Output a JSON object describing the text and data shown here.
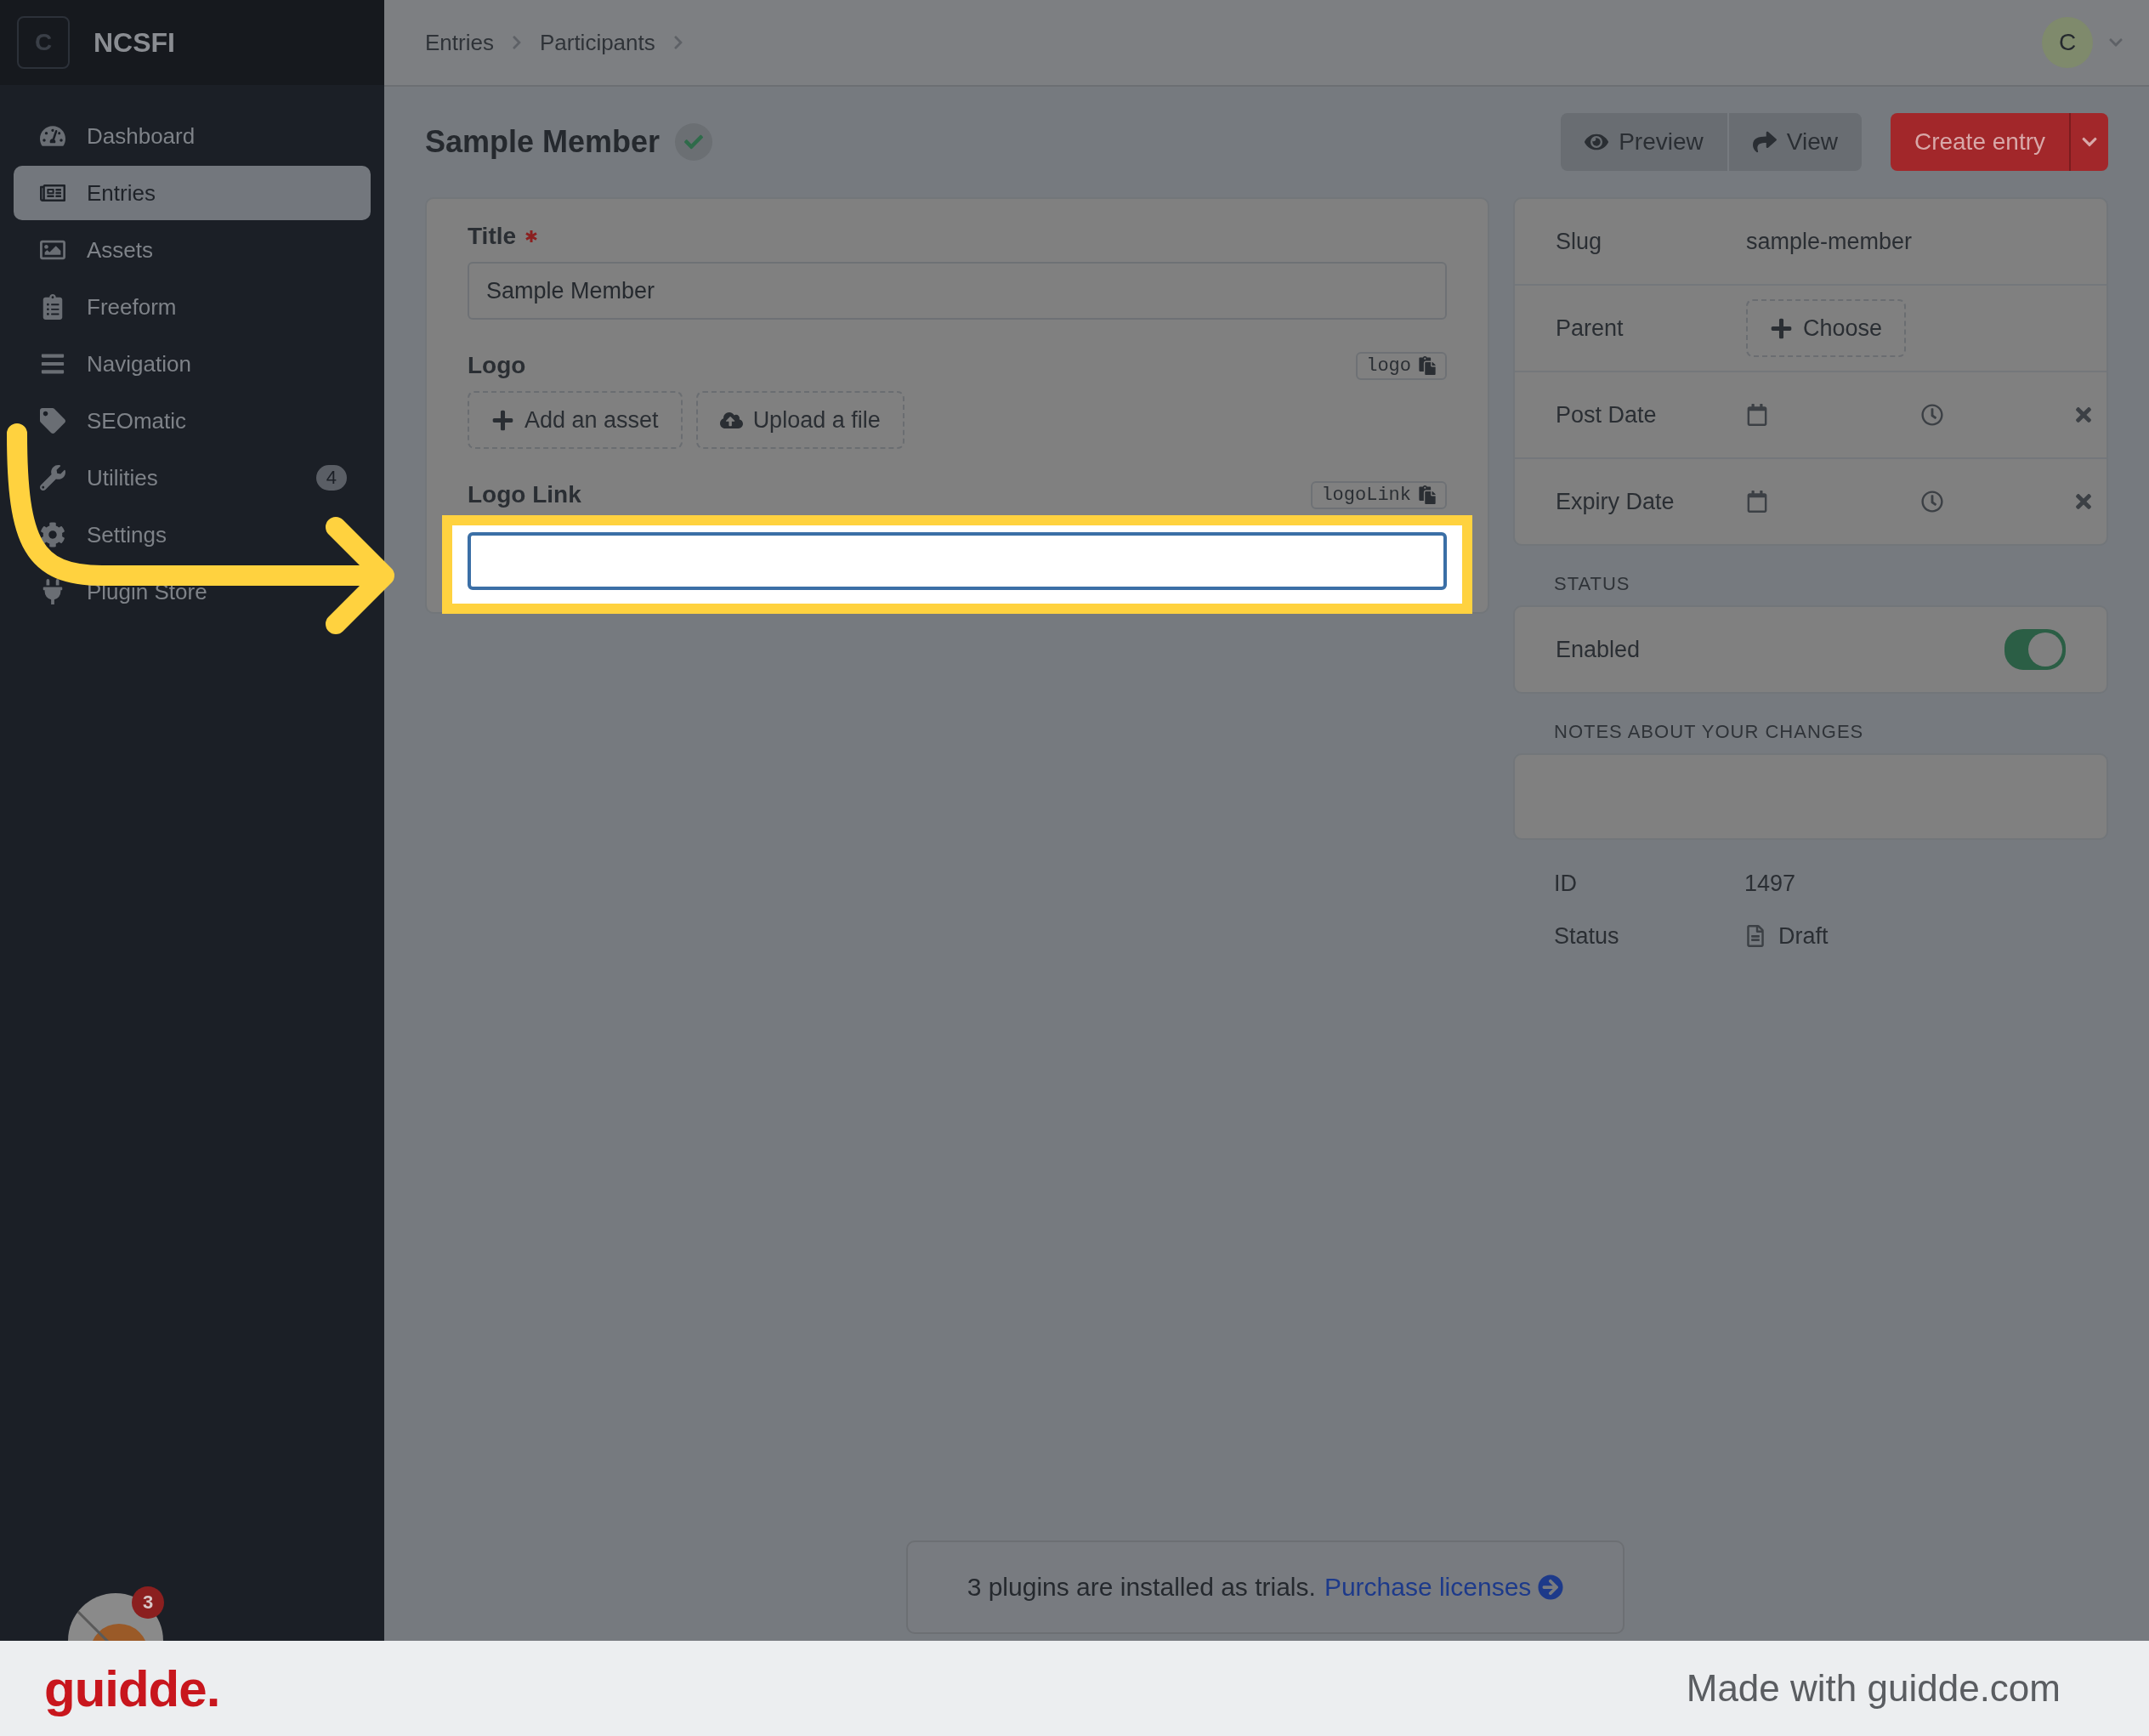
{
  "sidebar": {
    "brand_letter": "C",
    "brand_name": "NCSFI",
    "plugin_badge": "3",
    "items": [
      {
        "label": "Dashboard",
        "selected": false
      },
      {
        "label": "Entries",
        "selected": true
      },
      {
        "label": "Assets",
        "selected": false
      },
      {
        "label": "Freeform",
        "selected": false
      },
      {
        "label": "Navigation",
        "selected": false
      },
      {
        "label": "SEOmatic",
        "selected": false
      },
      {
        "label": "Utilities",
        "selected": false,
        "badge": "4"
      },
      {
        "label": "Settings",
        "selected": false
      },
      {
        "label": "Plugin Store",
        "selected": false
      }
    ]
  },
  "header": {
    "breadcrumbs": [
      "Entries",
      "Participants"
    ],
    "user_initial": "C"
  },
  "page": {
    "title": "Sample Member",
    "actions": [
      "Preview",
      "View"
    ],
    "primary": "Create entry"
  },
  "fields": [
    {
      "kind": "text",
      "label": "Title",
      "required": true,
      "value": "Sample Member",
      "highlighted": false
    },
    {
      "kind": "assets",
      "label": "Logo",
      "handle": "logo",
      "required": false,
      "buttons": [
        "Add an asset",
        "Upload a file"
      ],
      "highlighted": false
    },
    {
      "kind": "text",
      "label": "Logo Link",
      "handle": "logoLink",
      "required": false,
      "highlighted": true
    }
  ],
  "meta": [
    {
      "kind": "text",
      "label": "Slug",
      "value": "sample-member"
    },
    {
      "kind": "choose",
      "label": "Parent",
      "button": "Choose"
    },
    {
      "kind": "date",
      "label": "Post Date"
    },
    {
      "kind": "date",
      "label": "Expiry Date"
    }
  ],
  "status": {
    "heading": "STATUS",
    "label": "Enabled",
    "on": true
  },
  "notes": {
    "heading": "NOTES ABOUT YOUR CHANGES"
  },
  "info": [
    {
      "label": "ID",
      "value": "1497",
      "kind": "text"
    },
    {
      "label": "Status",
      "value": "Draft",
      "kind": "draft"
    }
  ],
  "notice": {
    "text": "3 plugins are installed as trials.",
    "link": "Purchase licenses"
  },
  "footer": {
    "brand": "guidde.",
    "credit": "Made with guidde.com"
  }
}
